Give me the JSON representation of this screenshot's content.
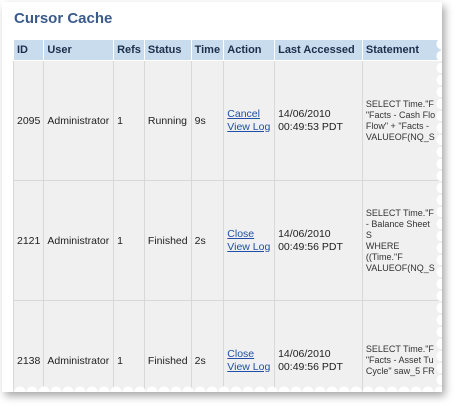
{
  "title": "Cursor Cache",
  "columns": [
    "ID",
    "User",
    "Refs",
    "Status",
    "Time",
    "Action",
    "Last Accessed",
    "Statement"
  ],
  "rows": [
    {
      "id": "2095",
      "user": "Administrator",
      "refs": "1",
      "status": "Running",
      "time": "9s",
      "actions": [
        "Cancel",
        "View Log"
      ],
      "accessed_date": "14/06/2010",
      "accessed_time": "00:49:53 PDT",
      "statement": [
        "SELECT Time.\"F",
        "\"Facts - Cash Flo",
        "Flow\" + \"Facts -",
        "VALUEOF(NQ_S"
      ]
    },
    {
      "id": "2121",
      "user": "Administrator",
      "refs": "1",
      "status": "Finished",
      "time": "2s",
      "actions": [
        "Close",
        "View Log"
      ],
      "accessed_date": "14/06/2010",
      "accessed_time": "00:49:56 PDT",
      "statement": [
        "SELECT Time.\"F",
        "- Balance Sheet S",
        "WHERE ((Time.\"F",
        "VALUEOF(NQ_S"
      ]
    },
    {
      "id": "2138",
      "user": "Administrator",
      "refs": "1",
      "status": "Finished",
      "time": "2s",
      "actions": [
        "Close",
        "View Log"
      ],
      "accessed_date": "14/06/2010",
      "accessed_time": "00:49:56 PDT",
      "statement": [
        "SELECT Time.\"F",
        "\"Facts - Asset Tu",
        "Cycle\" saw_5 FR"
      ]
    }
  ]
}
